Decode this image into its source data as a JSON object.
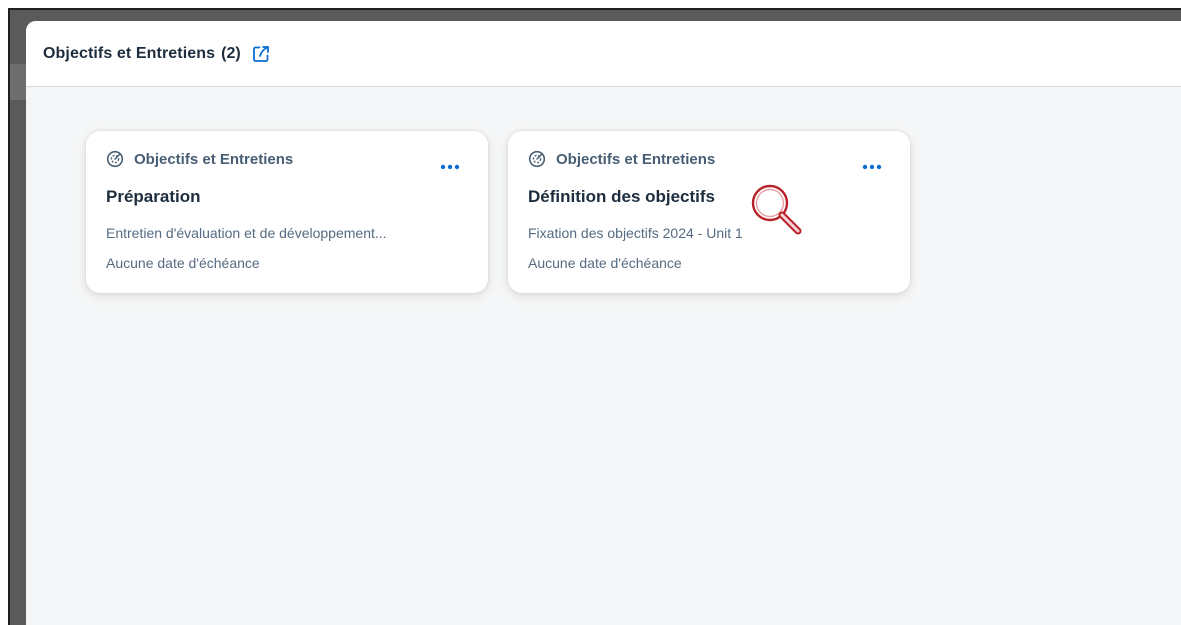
{
  "header": {
    "title": "Objectifs et Entretiens",
    "count": "(2)",
    "external_link_icon": "external-link-icon"
  },
  "cards": [
    {
      "category": "Objectifs et Entretiens",
      "category_icon": "target-gauge-icon",
      "title": "Préparation",
      "description": "Entretien d'évaluation et de développement...",
      "due": "Aucune date d'échéance",
      "more_icon": "more-dots-icon"
    },
    {
      "category": "Objectifs et Entretiens",
      "category_icon": "target-gauge-icon",
      "title": "Définition des objectifs",
      "description": "Fixation des objectifs 2024 - Unit 1",
      "due": "Aucune date d'échéance",
      "more_icon": "more-dots-icon"
    }
  ],
  "colors": {
    "accent": "#0a6ed1",
    "title": "#1d2d3e",
    "category": "#475e75",
    "secondary_text": "#556b82",
    "page_background": "#f5f6f7",
    "magnifier": "#b8232a"
  }
}
